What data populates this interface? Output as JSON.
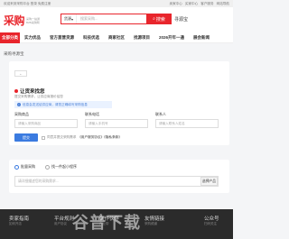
{
  "topbar": {
    "left": "欢迎来到采购平台",
    "login": "登录",
    "register": "免费注册",
    "links": [
      "卖家中心",
      "买家中心",
      "客户服务",
      "网站导航"
    ]
  },
  "header": {
    "logo": "采购",
    "logo_sub": "采购一站通\nB2B采购网",
    "search_select": "货源",
    "search_placeholder": "搜索采购...",
    "search_button": "搜索",
    "seek_label": "寻源宝"
  },
  "nav": {
    "category": "全部分类",
    "items": [
      "实力优品",
      "官方直营货源",
      "科技优选",
      "商家社区",
      "找源项目",
      "2026开年一通",
      "展会新闻"
    ]
  },
  "breadcrumb": "采购寻源宝",
  "form": {
    "back": "←",
    "title": "让货来找您",
    "desc": "提交采购需求，让供应商报价给您",
    "tip": "信息会发送给供应商，请您正确填写采购信息",
    "labels": [
      "采购商品",
      "联系电话",
      "联系人"
    ],
    "placeholders": [
      "请输入采购商品",
      "请输入手机号",
      "请输入联系人姓名"
    ],
    "submit": "提交",
    "agree_text": "同意并提交采购需求",
    "agree_link": "《用户服务协议》《隐私条款》"
  },
  "need": {
    "radios": [
      "批量采购",
      "找一件起小程序"
    ],
    "placeholder": "请详细描述您的采购需求...",
    "product_button": "选择产品"
  },
  "footer": {
    "cols": [
      "卖家指南",
      "平台规则",
      "合作伙伴",
      "友情链接",
      "公众号"
    ],
    "subs": [
      "如何开店",
      "用户协议",
      "产业带",
      "采购频道",
      "扫码关注"
    ],
    "watermark": "谷普下载"
  }
}
